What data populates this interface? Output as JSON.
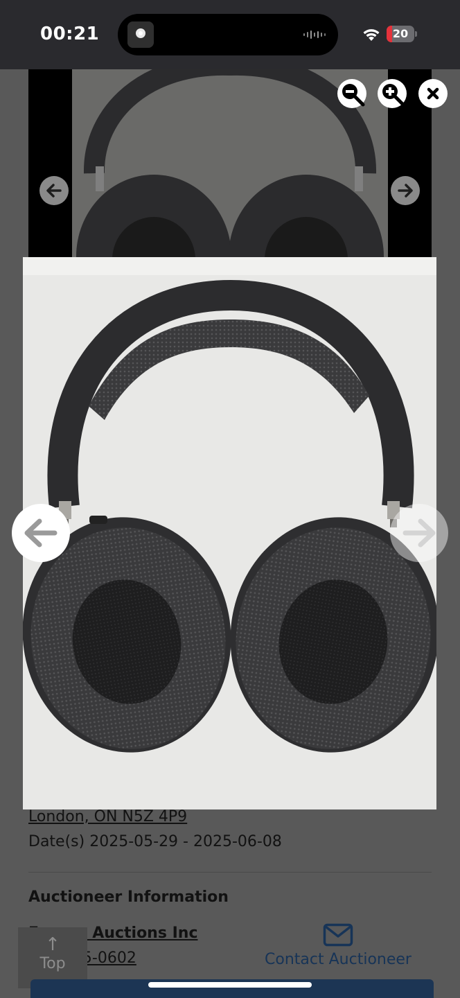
{
  "status_bar": {
    "time": "00:21",
    "battery_level": "20",
    "battery_fraction": 0.2,
    "icons": [
      "now-playing-thumbnail",
      "audio-waveform-icon",
      "wifi-icon",
      "battery-icon"
    ]
  },
  "gallery_toolbar": {
    "icons": [
      "zoom-out-icon",
      "zoom-in-icon",
      "close-icon"
    ]
  },
  "background_gallery": {
    "prev_icon": "arrow-left-icon",
    "next_icon": "arrow-right-icon"
  },
  "viewer": {
    "image_subject": "over-ear headphones",
    "prev_icon": "arrow-left-icon",
    "next_icon": "arrow-right-icon"
  },
  "listing": {
    "address_line": "London, ON N5Z 4P9",
    "dates": "Date(s) 2025-05-29 - 2025-06-08"
  },
  "auctioneer": {
    "heading": "Auctioneer Information",
    "name": "Encore Auctions Inc",
    "phone": "519-455-0602",
    "contact_label": "Contact Auctioneer",
    "contact_icon": "envelope-icon"
  },
  "scroll_top": {
    "label": "Top",
    "icon": "arrow-up-icon"
  },
  "colors": {
    "overlay": "#595959",
    "link_blue": "#173457",
    "battery_low": "#e5323b"
  }
}
